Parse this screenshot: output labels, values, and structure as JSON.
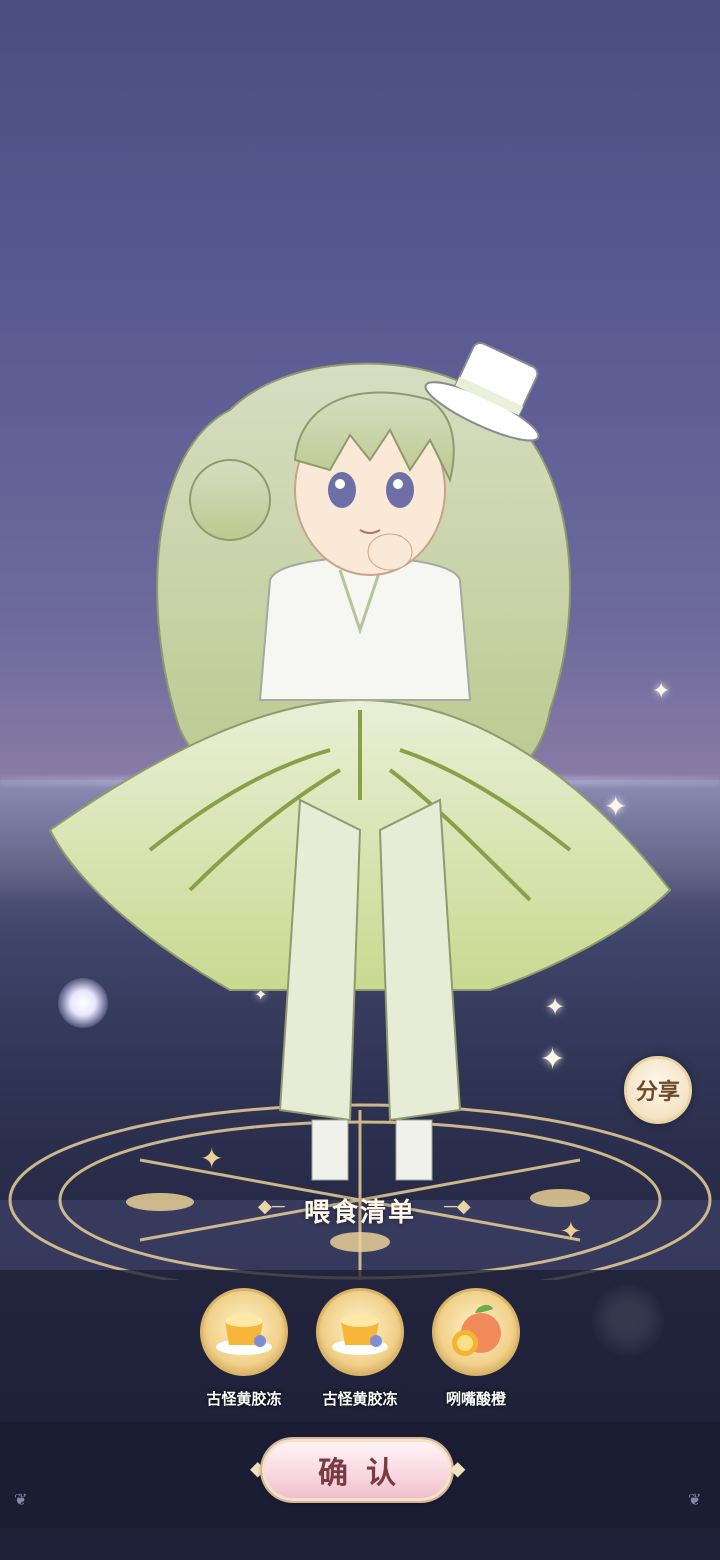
{
  "share": {
    "label": "分享"
  },
  "feed_list": {
    "title": "喂食清单",
    "items": [
      {
        "name": "古怪黄胶冻",
        "icon": "pudding-icon"
      },
      {
        "name": "古怪黄胶冻",
        "icon": "pudding-icon"
      },
      {
        "name": "咧嘴酸橙",
        "icon": "orange-icon"
      }
    ]
  },
  "confirm": {
    "label": "确认"
  },
  "colors": {
    "accent_gold": "#d9b567",
    "button_pink": "#f8d7df",
    "panel_dark": "#1e2037"
  }
}
